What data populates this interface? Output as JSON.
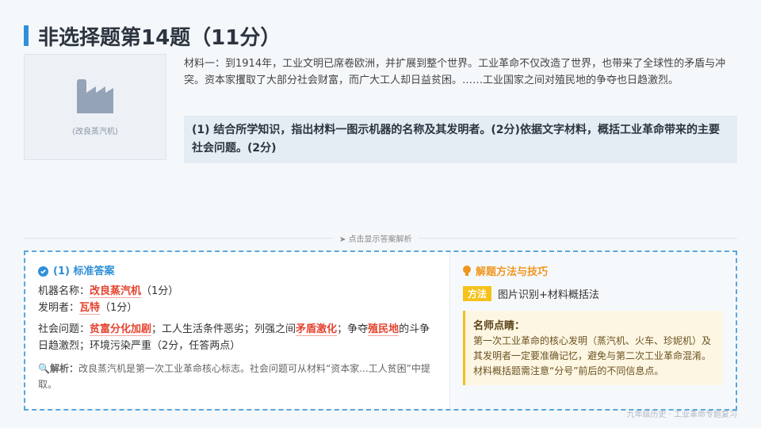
{
  "title": "非选择题第14题（11分）",
  "image": {
    "caption": "(改良蒸汽机)",
    "icon": "factory-icon"
  },
  "material": "材料一：到1914年，工业文明已席卷欧洲，并扩展到整个世界。工业革命不仅改造了世界，也带来了全球性的矛盾与冲突。资本家攫取了大部分社会财富，而广大工人却日益贫困。……工业国家之间对殖民地的争夺也日趋激烈。",
  "question": "(1) 结合所学知识，指出材料一图示机器的名称及其发明者。(2分)依据文字材料，概括工业革命带来的主要社会问题。(2分)",
  "reveal_label": "点击显示答案解析",
  "answer": {
    "heading": "(1) 标准答案",
    "machine_label": "机器名称：",
    "machine": "改良蒸汽机",
    "machine_score": "（1分）",
    "inventor_label": "发明者：",
    "inventor": "瓦特",
    "inventor_score": "（1分）",
    "social_label": "社会问题：",
    "s1": "贫富分化加剧",
    "s2": "；工人生活条件恶劣；列强之间",
    "s3": "矛盾激化",
    "s4": "；争夺",
    "s5": "殖民地",
    "s6": "的斗争日趋激烈；环境污染严重（2分，任答两点）",
    "analysis_label": "解析：",
    "analysis": "改良蒸汽机是第一次工业革命核心标志。社会问题可从材料“资本家...工人贫困”中提取。"
  },
  "tips": {
    "heading": "解题方法与技巧",
    "method_tag": "方法",
    "method": "图片识别+材料概括法",
    "tip_title": "名师点睛：",
    "tip_body": "第一次工业革命的核心发明（蒸汽机、火车、珍妮机）及其发明者一定要准确记忆，避免与第二次工业革命混淆。材料概括题需注意“分号”前后的不同信息点。"
  },
  "footer": "九年级历史 · 工业革命专题复习"
}
